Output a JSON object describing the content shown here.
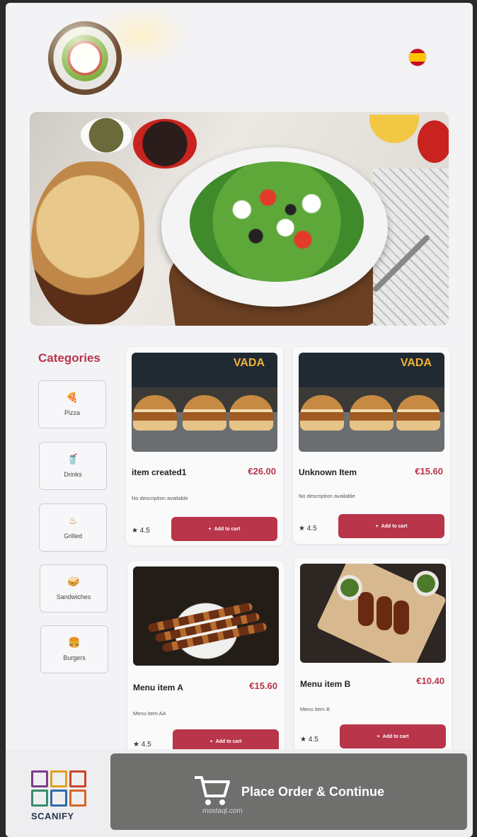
{
  "header": {
    "language_flag": "spain-flag"
  },
  "sidebar": {
    "title": "Categories",
    "items": [
      {
        "label": "Pizza",
        "icon": "pizza-icon",
        "glyph": "🍕"
      },
      {
        "label": "Drinks",
        "icon": "drink-icon",
        "glyph": "🥤"
      },
      {
        "label": "Grilled",
        "icon": "grill-icon",
        "glyph": "♨"
      },
      {
        "label": "Sandwiches",
        "icon": "sandwich-icon",
        "glyph": "🥪"
      },
      {
        "label": "Burgers",
        "icon": "burger-icon",
        "glyph": "🍔"
      }
    ]
  },
  "products": [
    {
      "name": "item created1",
      "price": "€26.00",
      "description": "No description available",
      "rating": "4.5",
      "add_label": "Add to cart"
    },
    {
      "name": "Unknown Item",
      "price": "€15.60",
      "description": "No description available",
      "rating": "4.5",
      "add_label": "Add to cart"
    },
    {
      "name": "Menu item A",
      "price": "€15.60",
      "description": "Menu item AA",
      "rating": "4.5",
      "add_label": "Add to cart"
    },
    {
      "name": "Menu item B",
      "price": "€10.40",
      "description": "Menu item B",
      "rating": "4.5",
      "add_label": "Add to cart"
    }
  ],
  "product_images": {
    "burger_sign": "VADA"
  },
  "footer": {
    "brand_name": "SCANIFY",
    "order_button": "Place Order & Continue",
    "watermark": "mostaql.com"
  },
  "colors": {
    "accent": "#b8354a",
    "order_button": "#6f6f6e",
    "background": "#f3f3f5"
  }
}
